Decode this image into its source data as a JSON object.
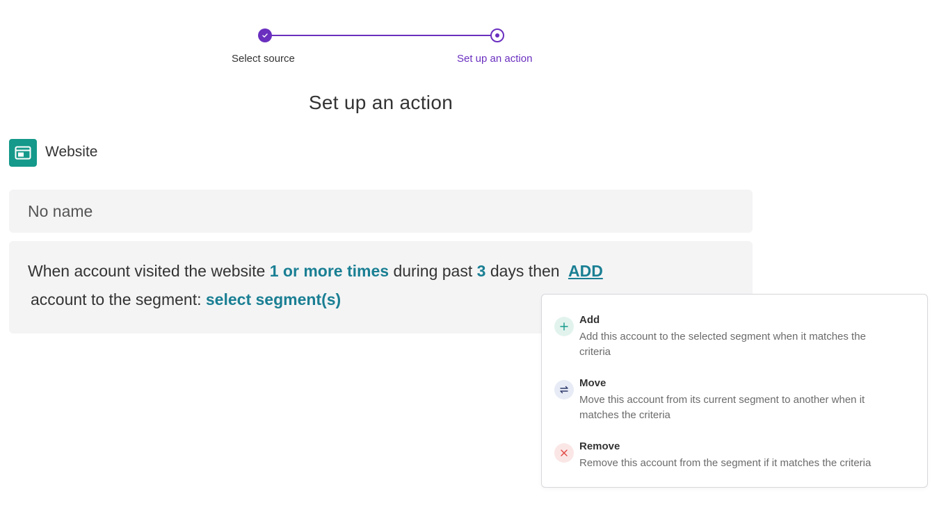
{
  "stepper": {
    "steps": [
      {
        "label": "Select source",
        "state": "done"
      },
      {
        "label": "Set up an action",
        "state": "current"
      }
    ],
    "accent": "#6a2fbf"
  },
  "page": {
    "title": "Set up an action"
  },
  "source": {
    "label": "Website",
    "icon": "browser-window-icon",
    "color": "#14998a"
  },
  "name_field": {
    "value": "No name"
  },
  "rule": {
    "prefix": "When account visited the website",
    "frequency": "1 or more times",
    "during": "during past",
    "days_value": "3",
    "days_suffix": "days then",
    "action": "ADD",
    "segment_prefix": "account to the segment:",
    "segment_value": "select segment(s)",
    "token_color": "#1a7f93"
  },
  "action_menu": {
    "options": [
      {
        "title": "Add",
        "description": "Add this account to the selected segment when it matches the criteria",
        "icon": "plus-icon",
        "color": "#14998a"
      },
      {
        "title": "Move",
        "description": "Move this account from its current segment to another when it matches the criteria",
        "icon": "swap-arrows-icon",
        "color": "#2e3a6b"
      },
      {
        "title": "Remove",
        "description": "Remove this account from the segment if it matches the criteria",
        "icon": "close-icon",
        "color": "#e0453f"
      }
    ]
  }
}
